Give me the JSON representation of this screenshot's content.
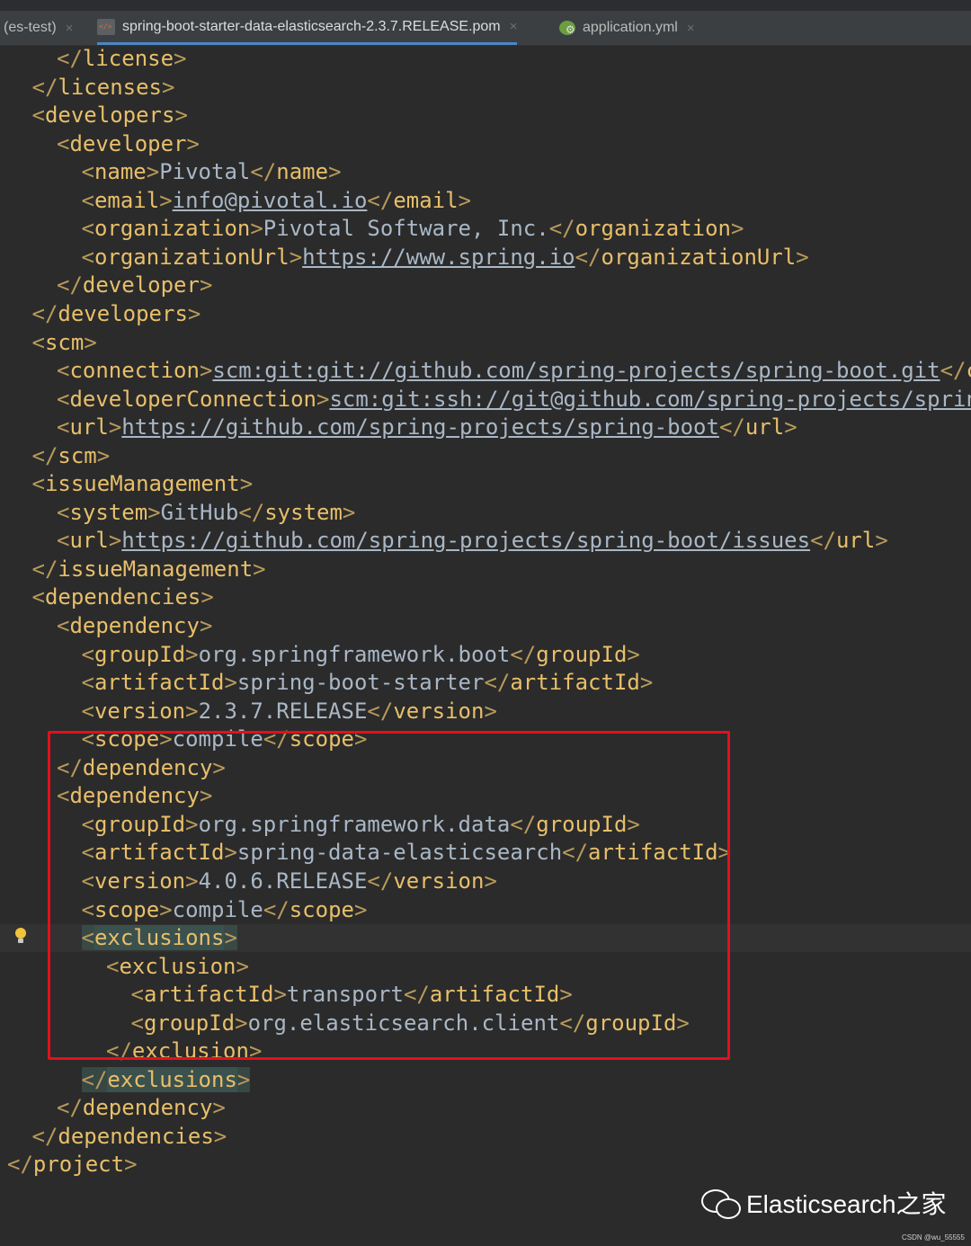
{
  "tabs": [
    {
      "label": "(es-test)",
      "active": false
    },
    {
      "label": "spring-boot-starter-data-elasticsearch-2.3.7.RELEASE.pom",
      "active": true,
      "icon": "xml-file-icon"
    },
    {
      "label": "application.yml",
      "active": false,
      "icon": "yml-file-icon"
    }
  ],
  "tab_close_glyph": "×",
  "code": {
    "lines": [
      {
        "indent": 2,
        "tokens": [
          [
            "b",
            "</"
          ],
          [
            "t",
            "license"
          ],
          [
            "b",
            ">"
          ]
        ]
      },
      {
        "indent": 1,
        "tokens": [
          [
            "b",
            "</"
          ],
          [
            "t",
            "licenses"
          ],
          [
            "b",
            ">"
          ]
        ]
      },
      {
        "indent": 1,
        "tokens": [
          [
            "b",
            "<"
          ],
          [
            "t",
            "developers"
          ],
          [
            "b",
            ">"
          ]
        ]
      },
      {
        "indent": 2,
        "tokens": [
          [
            "b",
            "<"
          ],
          [
            "t",
            "developer"
          ],
          [
            "b",
            ">"
          ]
        ]
      },
      {
        "indent": 3,
        "tokens": [
          [
            "b",
            "<"
          ],
          [
            "t",
            "name"
          ],
          [
            "b",
            ">"
          ],
          [
            "v",
            "Pivotal"
          ],
          [
            "b",
            "</"
          ],
          [
            "t",
            "name"
          ],
          [
            "b",
            ">"
          ]
        ]
      },
      {
        "indent": 3,
        "tokens": [
          [
            "b",
            "<"
          ],
          [
            "t",
            "email"
          ],
          [
            "b",
            ">"
          ],
          [
            "u",
            "info@pivotal.io"
          ],
          [
            "b",
            "</"
          ],
          [
            "t",
            "email"
          ],
          [
            "b",
            ">"
          ]
        ]
      },
      {
        "indent": 3,
        "tokens": [
          [
            "b",
            "<"
          ],
          [
            "t",
            "organization"
          ],
          [
            "b",
            ">"
          ],
          [
            "v",
            "Pivotal Software, Inc."
          ],
          [
            "b",
            "</"
          ],
          [
            "t",
            "organization"
          ],
          [
            "b",
            ">"
          ]
        ]
      },
      {
        "indent": 3,
        "tokens": [
          [
            "b",
            "<"
          ],
          [
            "t",
            "organizationUrl"
          ],
          [
            "b",
            ">"
          ],
          [
            "u",
            "https://www.spring.io"
          ],
          [
            "b",
            "</"
          ],
          [
            "t",
            "organizationUrl"
          ],
          [
            "b",
            ">"
          ]
        ]
      },
      {
        "indent": 2,
        "tokens": [
          [
            "b",
            "</"
          ],
          [
            "t",
            "developer"
          ],
          [
            "b",
            ">"
          ]
        ]
      },
      {
        "indent": 1,
        "tokens": [
          [
            "b",
            "</"
          ],
          [
            "t",
            "developers"
          ],
          [
            "b",
            ">"
          ]
        ]
      },
      {
        "indent": 1,
        "tokens": [
          [
            "b",
            "<"
          ],
          [
            "t",
            "scm"
          ],
          [
            "b",
            ">"
          ]
        ]
      },
      {
        "indent": 2,
        "tokens": [
          [
            "b",
            "<"
          ],
          [
            "t",
            "connection"
          ],
          [
            "b",
            ">"
          ],
          [
            "u",
            "scm:git:git://github.com/spring-projects/spring-boot.git"
          ],
          [
            "b",
            "</"
          ],
          [
            "t",
            "con"
          ]
        ]
      },
      {
        "indent": 2,
        "tokens": [
          [
            "b",
            "<"
          ],
          [
            "t",
            "developerConnection"
          ],
          [
            "b",
            ">"
          ],
          [
            "u",
            "scm:git:ssh://git@github.com/spring-projects/spring-"
          ]
        ]
      },
      {
        "indent": 2,
        "tokens": [
          [
            "b",
            "<"
          ],
          [
            "t",
            "url"
          ],
          [
            "b",
            ">"
          ],
          [
            "u",
            "https://github.com/spring-projects/spring-boot"
          ],
          [
            "b",
            "</"
          ],
          [
            "t",
            "url"
          ],
          [
            "b",
            ">"
          ]
        ]
      },
      {
        "indent": 1,
        "tokens": [
          [
            "b",
            "</"
          ],
          [
            "t",
            "scm"
          ],
          [
            "b",
            ">"
          ]
        ]
      },
      {
        "indent": 1,
        "tokens": [
          [
            "b",
            "<"
          ],
          [
            "t",
            "issueManagement"
          ],
          [
            "b",
            ">"
          ]
        ]
      },
      {
        "indent": 2,
        "tokens": [
          [
            "b",
            "<"
          ],
          [
            "t",
            "system"
          ],
          [
            "b",
            ">"
          ],
          [
            "v",
            "GitHub"
          ],
          [
            "b",
            "</"
          ],
          [
            "t",
            "system"
          ],
          [
            "b",
            ">"
          ]
        ]
      },
      {
        "indent": 2,
        "tokens": [
          [
            "b",
            "<"
          ],
          [
            "t",
            "url"
          ],
          [
            "b",
            ">"
          ],
          [
            "u",
            "https://github.com/spring-projects/spring-boot/issues"
          ],
          [
            "b",
            "</"
          ],
          [
            "t",
            "url"
          ],
          [
            "b",
            ">"
          ]
        ]
      },
      {
        "indent": 1,
        "tokens": [
          [
            "b",
            "</"
          ],
          [
            "t",
            "issueManagement"
          ],
          [
            "b",
            ">"
          ]
        ]
      },
      {
        "indent": 1,
        "tokens": [
          [
            "b",
            "<"
          ],
          [
            "t",
            "dependencies"
          ],
          [
            "b",
            ">"
          ]
        ]
      },
      {
        "indent": 2,
        "tokens": [
          [
            "b",
            "<"
          ],
          [
            "t",
            "dependency"
          ],
          [
            "b",
            ">"
          ]
        ]
      },
      {
        "indent": 3,
        "tokens": [
          [
            "b",
            "<"
          ],
          [
            "t",
            "groupId"
          ],
          [
            "b",
            ">"
          ],
          [
            "v",
            "org.springframework.boot"
          ],
          [
            "b",
            "</"
          ],
          [
            "t",
            "groupId"
          ],
          [
            "b",
            ">"
          ]
        ]
      },
      {
        "indent": 3,
        "tokens": [
          [
            "b",
            "<"
          ],
          [
            "t",
            "artifactId"
          ],
          [
            "b",
            ">"
          ],
          [
            "v",
            "spring-boot-starter"
          ],
          [
            "b",
            "</"
          ],
          [
            "t",
            "artifactId"
          ],
          [
            "b",
            ">"
          ]
        ]
      },
      {
        "indent": 3,
        "tokens": [
          [
            "b",
            "<"
          ],
          [
            "t",
            "version"
          ],
          [
            "b",
            ">"
          ],
          [
            "v",
            "2.3.7.RELEASE"
          ],
          [
            "b",
            "</"
          ],
          [
            "t",
            "version"
          ],
          [
            "b",
            ">"
          ]
        ]
      },
      {
        "indent": 3,
        "tokens": [
          [
            "b",
            "<"
          ],
          [
            "t",
            "scope"
          ],
          [
            "b",
            ">"
          ],
          [
            "v",
            "compile"
          ],
          [
            "b",
            "</"
          ],
          [
            "t",
            "scope"
          ],
          [
            "b",
            ">"
          ]
        ]
      },
      {
        "indent": 2,
        "tokens": [
          [
            "b",
            "</"
          ],
          [
            "t",
            "dependency"
          ],
          [
            "b",
            ">"
          ]
        ]
      },
      {
        "indent": 2,
        "tokens": [
          [
            "b",
            "<"
          ],
          [
            "t",
            "dependency"
          ],
          [
            "b",
            ">"
          ]
        ]
      },
      {
        "indent": 3,
        "tokens": [
          [
            "b",
            "<"
          ],
          [
            "t",
            "groupId"
          ],
          [
            "b",
            ">"
          ],
          [
            "v",
            "org.springframework.data"
          ],
          [
            "b",
            "</"
          ],
          [
            "t",
            "groupId"
          ],
          [
            "b",
            ">"
          ]
        ]
      },
      {
        "indent": 3,
        "tokens": [
          [
            "b",
            "<"
          ],
          [
            "t",
            "artifactId"
          ],
          [
            "b",
            ">"
          ],
          [
            "v",
            "spring-data-elasticsearch"
          ],
          [
            "b",
            "</"
          ],
          [
            "t",
            "artifactId"
          ],
          [
            "b",
            ">"
          ]
        ]
      },
      {
        "indent": 3,
        "tokens": [
          [
            "b",
            "<"
          ],
          [
            "t",
            "version"
          ],
          [
            "b",
            ">"
          ],
          [
            "v",
            "4.0.6.RELEASE"
          ],
          [
            "b",
            "</"
          ],
          [
            "t",
            "version"
          ],
          [
            "b",
            ">"
          ]
        ]
      },
      {
        "indent": 3,
        "tokens": [
          [
            "b",
            "<"
          ],
          [
            "t",
            "scope"
          ],
          [
            "b",
            ">"
          ],
          [
            "v",
            "compile"
          ],
          [
            "b",
            "</"
          ],
          [
            "t",
            "scope"
          ],
          [
            "b",
            ">"
          ]
        ]
      },
      {
        "indent": 3,
        "highlight": true,
        "bulb": true,
        "tokens": [
          [
            "mb",
            "<"
          ],
          [
            "mt",
            "exclusions"
          ],
          [
            "mb",
            ">"
          ]
        ]
      },
      {
        "indent": 4,
        "tokens": [
          [
            "b",
            "<"
          ],
          [
            "t",
            "exclusion"
          ],
          [
            "b",
            ">"
          ]
        ]
      },
      {
        "indent": 5,
        "tokens": [
          [
            "b",
            "<"
          ],
          [
            "t",
            "artifactId"
          ],
          [
            "b",
            ">"
          ],
          [
            "v",
            "transport"
          ],
          [
            "b",
            "</"
          ],
          [
            "t",
            "artifactId"
          ],
          [
            "b",
            ">"
          ]
        ]
      },
      {
        "indent": 5,
        "tokens": [
          [
            "b",
            "<"
          ],
          [
            "t",
            "groupId"
          ],
          [
            "b",
            ">"
          ],
          [
            "v",
            "org.elasticsearch.client"
          ],
          [
            "b",
            "</"
          ],
          [
            "t",
            "groupId"
          ],
          [
            "b",
            ">"
          ]
        ]
      },
      {
        "indent": 4,
        "tokens": [
          [
            "b",
            "</"
          ],
          [
            "t",
            "exclusion"
          ],
          [
            "b",
            ">"
          ]
        ]
      },
      {
        "indent": 3,
        "tokens": [
          [
            "mb",
            "</"
          ],
          [
            "mt",
            "exclusions"
          ],
          [
            "mb",
            ">"
          ]
        ]
      },
      {
        "indent": 2,
        "tokens": [
          [
            "b",
            "</"
          ],
          [
            "t",
            "dependency"
          ],
          [
            "b",
            ">"
          ]
        ]
      },
      {
        "indent": 1,
        "tokens": [
          [
            "b",
            "</"
          ],
          [
            "t",
            "dependencies"
          ],
          [
            "b",
            ">"
          ]
        ]
      },
      {
        "indent": 0,
        "tokens": [
          [
            "b",
            "</"
          ],
          [
            "t",
            "project"
          ],
          [
            "b",
            ">"
          ]
        ]
      }
    ]
  },
  "annotation": {
    "shape": "rectangle",
    "color": "#e3101d",
    "encloses": "second dependency block"
  },
  "watermark": {
    "text": "Elasticsearch之家",
    "icon": "wechat-icon"
  },
  "credit": "CSDN @wu_55555",
  "colors": {
    "tag": "#e8bf6a",
    "text": "#a9b7c6",
    "background": "#2b2b2b",
    "active_tab_underline": "#4a88c7",
    "match_highlight": "#3b514d"
  }
}
